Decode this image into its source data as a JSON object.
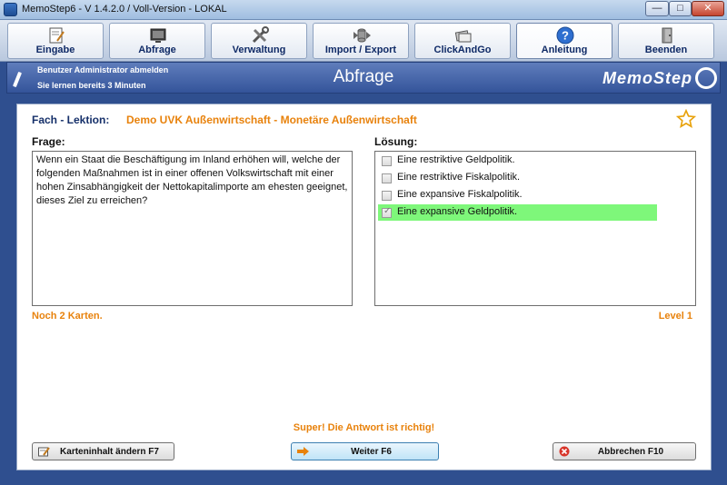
{
  "window": {
    "title": "MemoStep6 - V 1.4.2.0  /  Voll-Version  -  LOKAL",
    "min_glyph": "—",
    "max_glyph": "□",
    "close_glyph": "✕"
  },
  "toolbar": {
    "items": [
      {
        "label": "Eingabe",
        "icon": "document-pencil-icon"
      },
      {
        "label": "Abfrage",
        "icon": "query-screen-icon"
      },
      {
        "label": "Verwaltung",
        "icon": "tools-icon"
      },
      {
        "label": "Import / Export",
        "icon": "database-arrows-icon"
      },
      {
        "label": "ClickAndGo",
        "icon": "cards-pointer-icon"
      },
      {
        "label": "Anleitung",
        "icon": "help-icon",
        "glyph": "?"
      },
      {
        "label": "Beenden",
        "icon": "exit-door-icon"
      }
    ],
    "active": "Anleitung"
  },
  "header": {
    "user_action": "Benutzer Administrator abmelden",
    "learn_time": "Sie lernen bereits 3 Minuten",
    "page_title": "Abfrage",
    "logo": "MemoStep"
  },
  "main": {
    "fach_label": "Fach - Lektion:",
    "fach_value": "Demo UVK Außenwirtschaft - Monetäre Außenwirtschaft",
    "frage_label": "Frage:",
    "frage_text": "Wenn ein Staat die Beschäftigung im Inland erhöhen will, welche der folgenden Maßnahmen ist in einer offenen Volkswirtschaft mit einer hohen Zinsabhängigkeit der Nettokapitalimporte am ehesten geeignet, dieses Ziel zu erreichen?",
    "loesung_label": "Lösung:",
    "answers": [
      {
        "text": "Eine restriktive Geldpolitik.",
        "checked": false,
        "correct": false
      },
      {
        "text": "Eine restriktive Fiskalpolitik.",
        "checked": false,
        "correct": false
      },
      {
        "text": "Eine expansive Fiskalpolitik.",
        "checked": false,
        "correct": false
      },
      {
        "text": "Eine expansive Geldpolitik.",
        "checked": true,
        "correct": true
      }
    ],
    "cards_left": "Noch 2 Karten.",
    "level": "Level 1",
    "result": "Super! Die Antwort ist richtig!",
    "highlight_color": "#7ef77a",
    "accent_color": "#e8820c"
  },
  "buttons": {
    "edit": "Karteninhalt ändern  F7",
    "next": "Weiter  F6",
    "cancel": "Abbrechen  F10"
  }
}
